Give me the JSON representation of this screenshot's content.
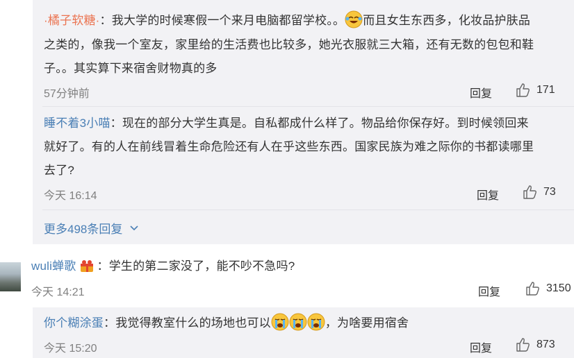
{
  "comments": {
    "r1": {
      "user": "·橘子软糖·",
      "line1_a": "：我大学的时候寒假一个来月电脑都留学校。。",
      "line1_b": "而且女生东西多，化妆品护肤品",
      "line2": "之类的，像我一个室友，家里给的生活费也比较多，她光衣服就三大箱，还有无数的包包和鞋",
      "line3": "子。。其实算下来宿舍财物真的多",
      "time": "57分钟前",
      "reply": "回复",
      "likes": "171",
      "emoji_icon": "laugh-cry-emoji"
    },
    "r2": {
      "user": "睡不着3小喵",
      "line1": "：现在的部分大学生真是。自私都成什么样了。物品给你保存好。到时候领回来",
      "line2": "就好了。有的人在前线冒着生命危险还有人在乎这些东西。国家民族为难之际你的书都读哪里",
      "line3": "去了?",
      "time": "今天 16:14",
      "reply": "回复",
      "likes": "73"
    },
    "more_replies": "更多498条回复",
    "main": {
      "user": "wuli蝉歌",
      "text": "：学生的第二家没了，能不吵不急吗?",
      "time": "今天 14:21",
      "reply": "回复",
      "likes": "3150",
      "badge_icon": "gift-badge-icon"
    },
    "r3": {
      "user": "你个糊涂蛋",
      "text_a": "：我觉得教室什么的场地也可以",
      "text_b": "，为啥要用宿舍",
      "time": "今天 15:20",
      "reply": "回复",
      "likes": "873",
      "emoji_icon": "crying-emoji"
    }
  },
  "colors": {
    "nested_bg": "#f2f2f5",
    "link_blue": "#4a7fb5",
    "username_orange": "#eb7350"
  }
}
